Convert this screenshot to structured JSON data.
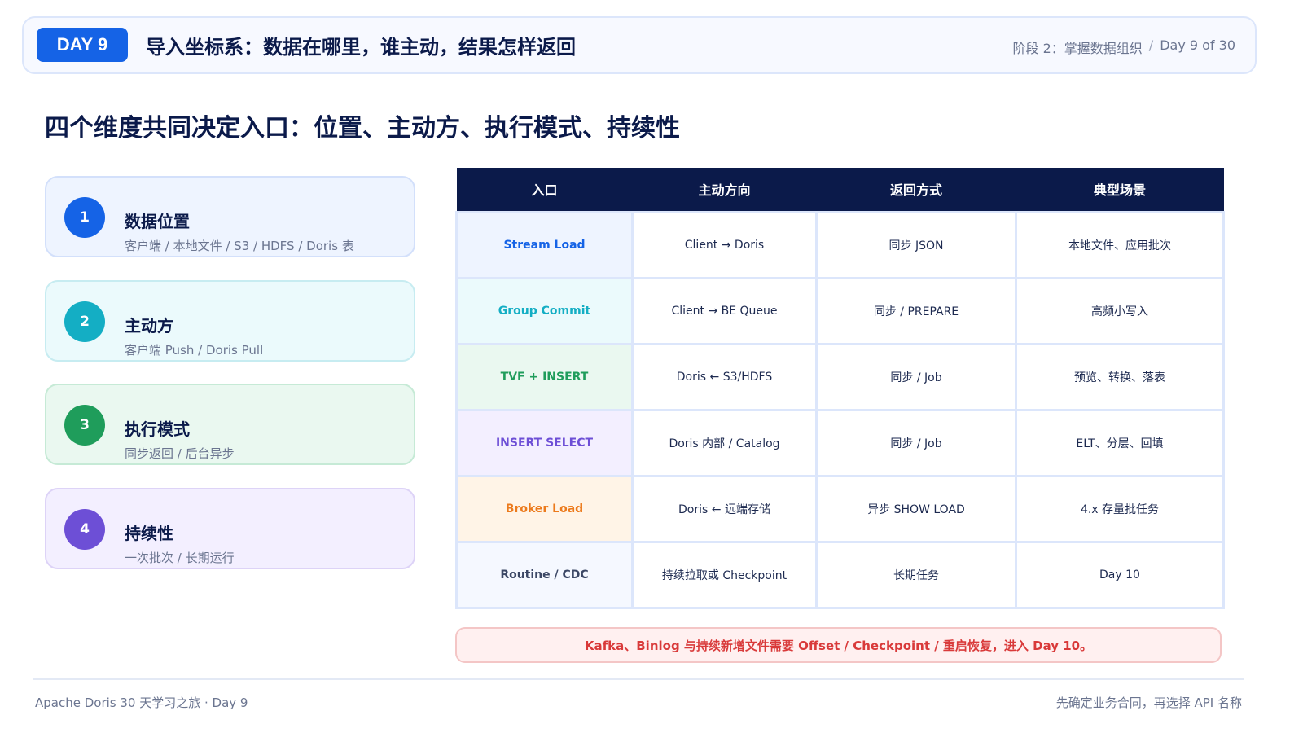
{
  "header": {
    "badge": "DAY 9",
    "title": "导入坐标系：数据在哪里，谁主动，结果怎样返回",
    "stage": "阶段 2：掌握数据组织",
    "separator": "/",
    "progress": "Day 9 of 30"
  },
  "section_title": "四个维度共同决定入口：位置、主动方、执行模式、持续性",
  "dimensions": [
    {
      "num": "1",
      "title": "数据位置",
      "subtitle": "客户端 / 本地文件 / S3 / HDFS / Doris 表"
    },
    {
      "num": "2",
      "title": "主动方",
      "subtitle": "客户端 Push / Doris Pull"
    },
    {
      "num": "3",
      "title": "执行模式",
      "subtitle": "同步返回 / 后台异步"
    },
    {
      "num": "4",
      "title": "持续性",
      "subtitle": "一次批次 / 长期运行"
    }
  ],
  "table": {
    "headers": [
      "入口",
      "主动方向",
      "返回方式",
      "典型场景"
    ],
    "rows": [
      [
        "Stream Load",
        "Client → Doris",
        "同步 JSON",
        "本地文件、应用批次"
      ],
      [
        "Group Commit",
        "Client → BE Queue",
        "同步 / PREPARE",
        "高频小写入"
      ],
      [
        "TVF + INSERT",
        "Doris ← S3/HDFS",
        "同步 / Job",
        "预览、转换、落表"
      ],
      [
        "INSERT SELECT",
        "Doris 内部 / Catalog",
        "同步 / Job",
        "ELT、分层、回填"
      ],
      [
        "Broker Load",
        "Doris ← 远端存储",
        "异步 SHOW LOAD",
        "4.x 存量批任务"
      ],
      [
        "Routine / CDC",
        "持续拉取或 Checkpoint",
        "长期任务",
        "Day 10"
      ]
    ]
  },
  "note": "Kafka、Binlog 与持续新增文件需要 Offset / Checkpoint / 重启恢复，进入 Day 10。",
  "footer": {
    "left": "Apache Doris 30 天学习之旅 · Day 9",
    "right": "先确定业务合同，再选择 API 名称"
  }
}
